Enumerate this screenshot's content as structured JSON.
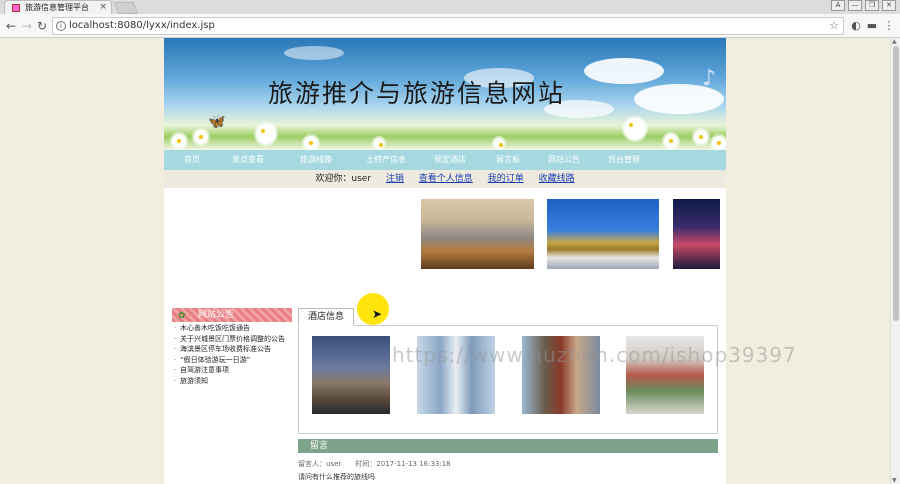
{
  "browser": {
    "tab_title": "旅游信息管理平台",
    "tab_close": "×",
    "url": "localhost:8080/lyxx/index.jsp",
    "window_buttons": [
      "A",
      "—",
      "❐",
      "✕"
    ]
  },
  "site": {
    "banner_title": "旅游推介与旅游信息网站",
    "menu": [
      "首页",
      "景点查看",
      "旅游线路",
      "土特产信息",
      "预定酒店",
      "留言板",
      "网站公告",
      "后台管理"
    ],
    "userbar": {
      "welcome": "欢迎你：user",
      "links": [
        "注销",
        "查看个人信息",
        "我的订单",
        "收藏线路"
      ]
    },
    "notices": {
      "title": "网站公告",
      "items": [
        "木心善木吃饭吃饭通告",
        "关于兴城景区门票价格调整的公告",
        "海滨景区停车场收费标准公告",
        "“假日体验游玩一日游”",
        "自驾游注意事项",
        "旅游须知"
      ]
    },
    "hotel_section": {
      "tab_label": "酒店信息"
    },
    "messages": {
      "title": "留言",
      "meta": "留言人：user　　时间：2017-11-13 16:33:18",
      "body": "请问有什么推荐的旅线吗"
    }
  },
  "watermark": "https://www.huzhan.com/ishop39397",
  "colors": {
    "menubar": "#a6d8e0",
    "notice_header": "#e97f83",
    "message_header": "#7da48a",
    "link": "#1a3eb0"
  }
}
